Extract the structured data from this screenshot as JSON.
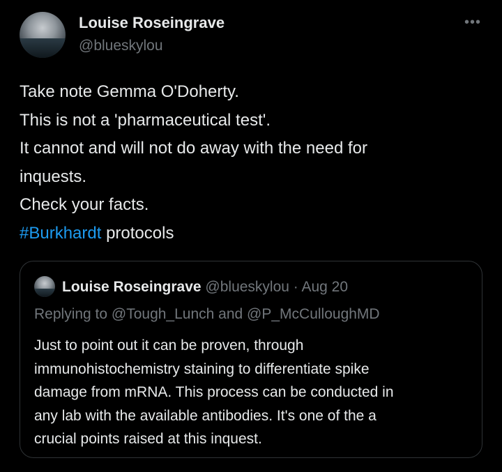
{
  "author": {
    "display_name": "Louise Roseingrave",
    "handle": "@blueskylou"
  },
  "more_icon": "more-horizontal-icon",
  "more_glyph": "•••",
  "tweet": {
    "lines": [
      "Take note Gemma O'Doherty.",
      "This is not a 'pharmaceutical test'.",
      "It cannot and will not do away with the need for",
      "inquests.",
      "Check your facts."
    ],
    "hashtag": "#Burkhardt",
    "after_hashtag": " protocols"
  },
  "quote": {
    "display_name": "Louise Roseingrave",
    "handle": "@blueskylou",
    "separator": " · ",
    "date": "Aug 20",
    "replying_to": "Replying to @Tough_Lunch and @P_McCulloughMD",
    "lines": [
      "Just to point out it can be proven, through",
      "immunohistochemistry staining to differentiate spike",
      "damage from mRNA. This process can be conducted in",
      "any lab with the available antibodies. It's one of the a",
      "crucial points raised at this inquest."
    ]
  }
}
